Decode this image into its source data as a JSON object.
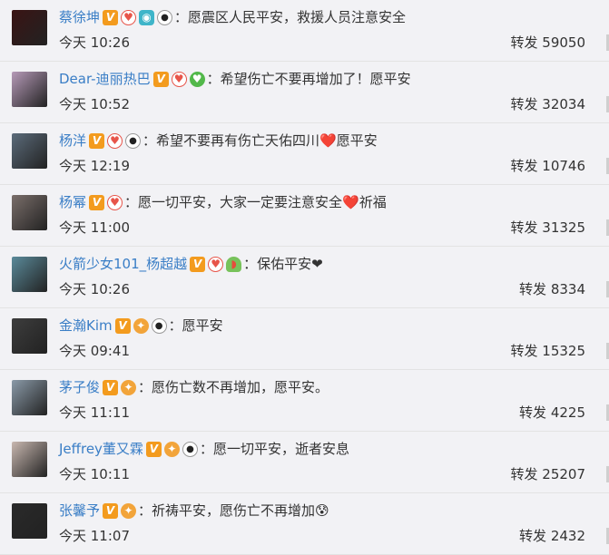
{
  "colors": {
    "name": "#3a7ec6",
    "background": "#f2f2f5",
    "verified_badge": "#f39b1e"
  },
  "share_label": "转发",
  "rows": [
    {
      "name": "蔡徐坤",
      "badges": [
        "verified-icon",
        "club-icon",
        "camera-icon",
        "panda-icon"
      ],
      "comment": "：愿震区人民平安，救援人员注意安全",
      "time": "今天 10:26",
      "share_count": "59050"
    },
    {
      "name": "Dear-迪丽热巴",
      "badges": [
        "verified-icon",
        "club-icon",
        "heart-icon"
      ],
      "comment": "：希望伤亡不要再增加了！愿平安",
      "time": "今天 10:52",
      "share_count": "32034"
    },
    {
      "name": "杨洋",
      "badges": [
        "verified-icon",
        "club-icon",
        "panda-icon"
      ],
      "comment": "：希望不要再有伤亡天佑四川❤️愿平安",
      "time": "今天 12:19",
      "share_count": "10746"
    },
    {
      "name": "杨幂",
      "badges": [
        "verified-icon",
        "club-icon"
      ],
      "comment": "：愿一切平安，大家一定要注意安全❤️祈福",
      "time": "今天 11:00",
      "share_count": "31325"
    },
    {
      "name": "火箭少女101_杨超越",
      "badges": [
        "verified-icon",
        "club-icon",
        "watermelon-icon"
      ],
      "comment": "：保佑平安❤",
      "time": "今天 10:26",
      "share_count": "8334"
    },
    {
      "name": "金瀚Kim",
      "badges": [
        "verified-icon",
        "gift-icon",
        "panda-icon"
      ],
      "comment": "：愿平安",
      "time": "今天 09:41",
      "share_count": "15325"
    },
    {
      "name": "茅子俊",
      "badges": [
        "verified-icon",
        "gift-icon"
      ],
      "comment": "：愿伤亡数不再增加，愿平安。",
      "time": "今天 11:11",
      "share_count": "4225"
    },
    {
      "name": "Jeffrey董又霖",
      "badges": [
        "verified-icon",
        "gift-icon",
        "panda-icon"
      ],
      "comment": "：愿一切平安，逝者安息",
      "time": "今天 10:11",
      "share_count": "25207"
    },
    {
      "name": "张馨予",
      "badges": [
        "verified-icon",
        "gift-icon"
      ],
      "comment": "：祈祷平安，愿伤亡不再增加😰",
      "time": "今天 11:07",
      "share_count": "2432"
    }
  ]
}
